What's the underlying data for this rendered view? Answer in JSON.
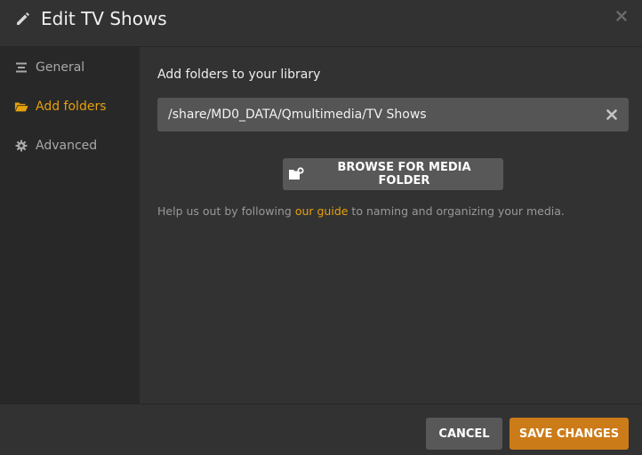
{
  "dialog": {
    "title": "Edit TV Shows",
    "close_icon": "close-icon",
    "title_icon": "pencil-icon"
  },
  "sidebar": {
    "items": [
      {
        "label": "General",
        "icon": "list-icon",
        "active": false
      },
      {
        "label": "Add folders",
        "icon": "folder-open-icon",
        "active": true
      },
      {
        "label": "Advanced",
        "icon": "gear-icon",
        "active": false
      }
    ]
  },
  "main": {
    "heading": "Add folders to your library",
    "folder_path": "/share/MD0_DATA/Qmultimedia/TV Shows",
    "browse_label": "BROWSE FOR MEDIA FOLDER",
    "help_prefix": "Help us out by following ",
    "help_link": "our guide",
    "help_suffix": " to naming and organizing your media."
  },
  "footer": {
    "cancel_label": "CANCEL",
    "save_label": "SAVE CHANGES"
  },
  "colors": {
    "accent": "#e5a00d",
    "save_button": "#cc7b19",
    "background": "#323232",
    "sidebar": "#282828"
  }
}
